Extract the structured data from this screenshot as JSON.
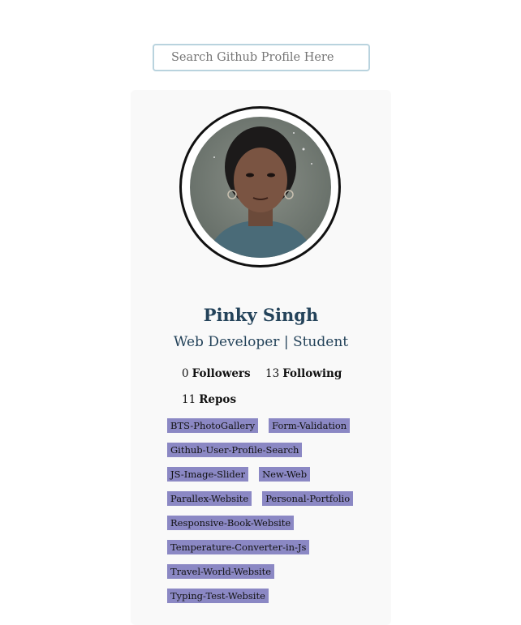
{
  "search": {
    "placeholder": "Search Github Profile Here"
  },
  "profile": {
    "name": "Pinky Singh",
    "bio": "Web Developer | Student",
    "followers": {
      "count": "0",
      "label": "Followers"
    },
    "following": {
      "count": "13",
      "label": "Following"
    },
    "repos": {
      "count": "11",
      "label": "Repos"
    }
  },
  "repositories": [
    "BTS-PhotoGallery",
    "Form-Validation",
    "Github-User-Profile-Search",
    "JS-Image-Slider",
    "New-Web",
    "Parallex-Website",
    "Personal-Portfolio",
    "Responsive-Book-Website",
    "Temperature-Converter-in-Js",
    "Travel-World-Website",
    "Typing-Test-Website"
  ],
  "colors": {
    "accent_text": "#24435a",
    "repo_tag_bg": "#8b88c4",
    "search_border": "#b9d3de",
    "card_bg": "#f9f9f9"
  }
}
